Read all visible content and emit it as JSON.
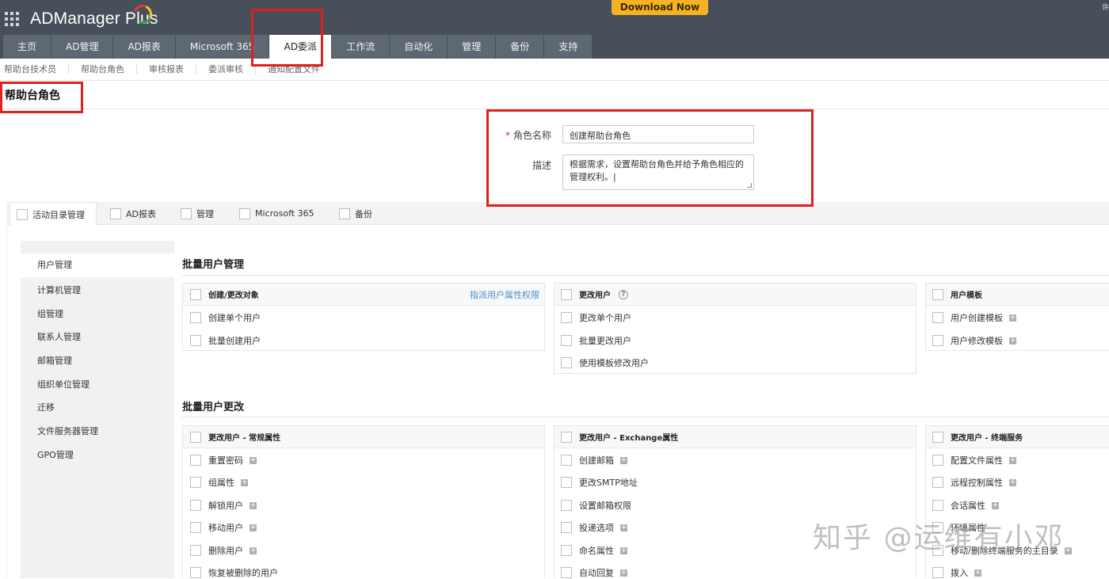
{
  "header": {
    "logo_text": "ADManager Plus",
    "download_label": "Download Now",
    "corner_glyph": "许"
  },
  "tabs": [
    {
      "label": "主页"
    },
    {
      "label": "AD管理"
    },
    {
      "label": "AD报表"
    },
    {
      "label": "Microsoft 365"
    },
    {
      "label": "AD委派",
      "active": true
    },
    {
      "label": "工作流"
    },
    {
      "label": "自动化"
    },
    {
      "label": "管理"
    },
    {
      "label": "备份"
    },
    {
      "label": "支持"
    }
  ],
  "subnav": [
    "帮助台技术员",
    "帮助台角色",
    "审核报表",
    "委派审核",
    "通知配置文件"
  ],
  "page_title": "帮助台角色",
  "form": {
    "role_name_label": "角色名称",
    "role_name_value": "创建帮助台角色",
    "desc_label": "描述",
    "desc_value": "根据需求，设置帮助台角色并给予角色相应的管理权利。|"
  },
  "categories": [
    "活动目录管理",
    "AD报表",
    "管理",
    "Microsoft 365",
    "备份"
  ],
  "side_menu": [
    "用户管理",
    "计算机管理",
    "组管理",
    "联系人管理",
    "邮箱管理",
    "组织单位管理",
    "迁移",
    "文件服务器管理",
    "GPO管理"
  ],
  "sections": {
    "bulk_user_mgmt": {
      "title": "批量用户管理",
      "cards": [
        {
          "title": "创建/更改对象",
          "link": "指派用户属性权限",
          "items": [
            "创建单个用户",
            "批量创建用户"
          ]
        },
        {
          "title": "更改用户",
          "items": [
            "更改单个用户",
            "批量更改用户",
            "使用模板修改用户"
          ]
        },
        {
          "title": "用户模板",
          "items": [
            "用户创建模板",
            "用户修改模板"
          ]
        }
      ]
    },
    "bulk_user_change": {
      "title": "批量用户更改",
      "cards": [
        {
          "title": "更改用户 - 常规属性",
          "items": [
            "重置密码",
            "组属性",
            "解锁用户",
            "移动用户",
            "删除用户",
            "恢复被删除的用户"
          ]
        },
        {
          "title": "更改用户 - Exchange属性",
          "items": [
            "创建邮箱",
            "更改SMTP地址",
            "设置邮箱权限",
            "投递选项",
            "命名属性",
            "自动回复"
          ]
        },
        {
          "title": "更改用户 - 终端服务",
          "items": [
            "配置文件属性",
            "远程控制属性",
            "会话属性",
            "环境属性",
            "移动/删除终端服务的主目录",
            "拨入"
          ]
        }
      ]
    }
  },
  "watermark": "知乎 @运维有小邓",
  "colors": {
    "highlight": "#e0201e",
    "header_bg": "#47505a",
    "tab_bg": "#5e6873",
    "download_bg": "#f5b324",
    "link": "#4a8fc7"
  }
}
